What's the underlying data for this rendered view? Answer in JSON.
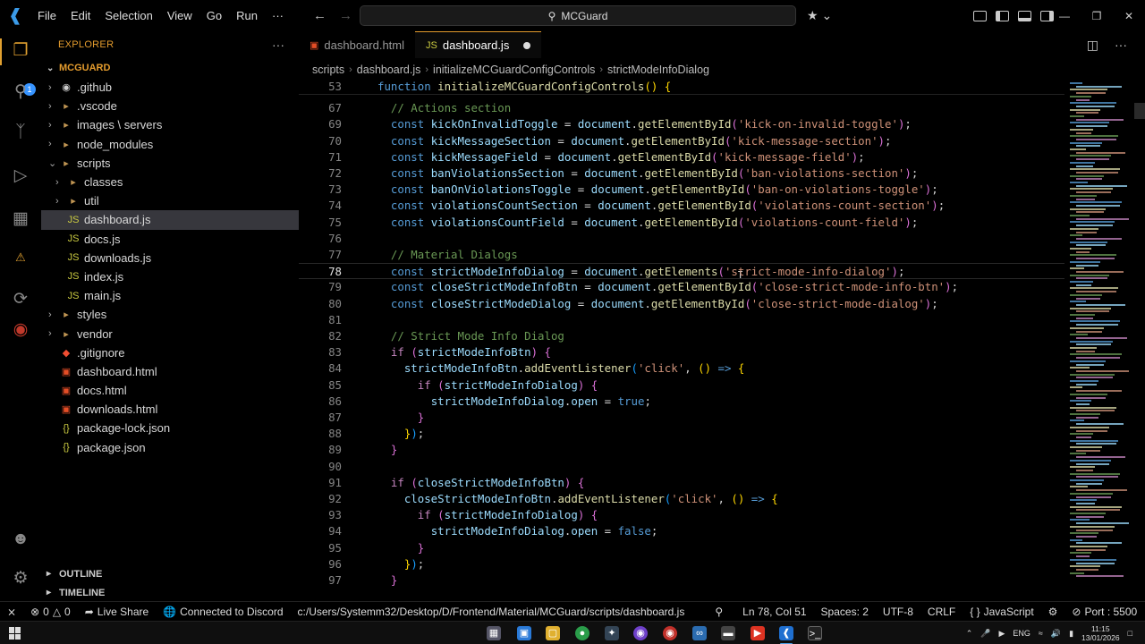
{
  "titlebar": {
    "menu": [
      "File",
      "Edit",
      "Selection",
      "View",
      "Go",
      "Run",
      "···"
    ],
    "search": "MCGuard"
  },
  "activity": {
    "badge": "1"
  },
  "sidebar": {
    "title": "EXPLORER",
    "more": "···",
    "root": "MCGUARD",
    "items": [
      {
        "label": ".github",
        "kind": "folder-gh",
        "indent": 0,
        "chev": "›"
      },
      {
        "label": ".vscode",
        "kind": "folder",
        "indent": 0,
        "chev": "›"
      },
      {
        "label": "images \\ servers",
        "kind": "folder",
        "indent": 0,
        "chev": "›"
      },
      {
        "label": "node_modules",
        "kind": "folder",
        "indent": 0,
        "chev": "›"
      },
      {
        "label": "scripts",
        "kind": "folder",
        "indent": 0,
        "chev": "⌄"
      },
      {
        "label": "classes",
        "kind": "folder",
        "indent": 1,
        "chev": "›"
      },
      {
        "label": "util",
        "kind": "folder",
        "indent": 1,
        "chev": "›"
      },
      {
        "label": "dashboard.js",
        "kind": "js",
        "indent": 1,
        "chev": "",
        "selected": true
      },
      {
        "label": "docs.js",
        "kind": "js",
        "indent": 1,
        "chev": ""
      },
      {
        "label": "downloads.js",
        "kind": "js",
        "indent": 1,
        "chev": ""
      },
      {
        "label": "index.js",
        "kind": "js",
        "indent": 1,
        "chev": ""
      },
      {
        "label": "main.js",
        "kind": "js",
        "indent": 1,
        "chev": ""
      },
      {
        "label": "styles",
        "kind": "folder",
        "indent": 0,
        "chev": "›"
      },
      {
        "label": "vendor",
        "kind": "folder",
        "indent": 0,
        "chev": "›"
      },
      {
        "label": ".gitignore",
        "kind": "git",
        "indent": 0,
        "chev": ""
      },
      {
        "label": "dashboard.html",
        "kind": "html",
        "indent": 0,
        "chev": ""
      },
      {
        "label": "docs.html",
        "kind": "html",
        "indent": 0,
        "chev": ""
      },
      {
        "label": "downloads.html",
        "kind": "html",
        "indent": 0,
        "chev": ""
      },
      {
        "label": "package-lock.json",
        "kind": "json",
        "indent": 0,
        "chev": ""
      },
      {
        "label": "package.json",
        "kind": "json",
        "indent": 0,
        "chev": ""
      }
    ],
    "outline": "OUTLINE",
    "timeline": "TIMELINE"
  },
  "tabs": [
    {
      "label": "dashboard.html",
      "kind": "html",
      "active": false
    },
    {
      "label": "dashboard.js",
      "kind": "js",
      "active": true,
      "dirty": true
    }
  ],
  "breadcrumb": [
    "scripts",
    "dashboard.js",
    "initializeMCGuardConfigControls",
    "strictModeInfoDialog"
  ],
  "editor": {
    "cursor_line": 78,
    "lines": [
      {
        "n": "53",
        "sticky": true,
        "t": [
          [
            "kw",
            "function "
          ],
          [
            "fn",
            "initializeMCGuardConfigControls"
          ],
          [
            "br1",
            "()"
          ],
          [
            "op",
            " "
          ],
          [
            "br1",
            "{"
          ]
        ]
      },
      {
        "n": "67",
        "t": [
          [
            "op",
            "  "
          ],
          [
            "cm",
            "// Actions section"
          ]
        ]
      },
      {
        "n": "69",
        "t": [
          [
            "op",
            "  "
          ],
          [
            "kw",
            "const "
          ],
          [
            "var",
            "kickOnInvalidToggle"
          ],
          [
            "op",
            " = "
          ],
          [
            "var",
            "document"
          ],
          [
            "op",
            "."
          ],
          [
            "fn",
            "getElementById"
          ],
          [
            "br2",
            "("
          ],
          [
            "str",
            "'kick-on-invalid-toggle'"
          ],
          [
            "br2",
            ")"
          ],
          [
            "op",
            ";"
          ]
        ]
      },
      {
        "n": "70",
        "t": [
          [
            "op",
            "  "
          ],
          [
            "kw",
            "const "
          ],
          [
            "var",
            "kickMessageSection"
          ],
          [
            "op",
            " = "
          ],
          [
            "var",
            "document"
          ],
          [
            "op",
            "."
          ],
          [
            "fn",
            "getElementById"
          ],
          [
            "br2",
            "("
          ],
          [
            "str",
            "'kick-message-section'"
          ],
          [
            "br2",
            ")"
          ],
          [
            "op",
            ";"
          ]
        ]
      },
      {
        "n": "71",
        "t": [
          [
            "op",
            "  "
          ],
          [
            "kw",
            "const "
          ],
          [
            "var",
            "kickMessageField"
          ],
          [
            "op",
            " = "
          ],
          [
            "var",
            "document"
          ],
          [
            "op",
            "."
          ],
          [
            "fn",
            "getElementById"
          ],
          [
            "br2",
            "("
          ],
          [
            "str",
            "'kick-message-field'"
          ],
          [
            "br2",
            ")"
          ],
          [
            "op",
            ";"
          ]
        ]
      },
      {
        "n": "72",
        "t": [
          [
            "op",
            "  "
          ],
          [
            "kw",
            "const "
          ],
          [
            "var",
            "banViolationsSection"
          ],
          [
            "op",
            " = "
          ],
          [
            "var",
            "document"
          ],
          [
            "op",
            "."
          ],
          [
            "fn",
            "getElementById"
          ],
          [
            "br2",
            "("
          ],
          [
            "str",
            "'ban-violations-section'"
          ],
          [
            "br2",
            ")"
          ],
          [
            "op",
            ";"
          ]
        ]
      },
      {
        "n": "73",
        "t": [
          [
            "op",
            "  "
          ],
          [
            "kw",
            "const "
          ],
          [
            "var",
            "banOnViolationsToggle"
          ],
          [
            "op",
            " = "
          ],
          [
            "var",
            "document"
          ],
          [
            "op",
            "."
          ],
          [
            "fn",
            "getElementById"
          ],
          [
            "br2",
            "("
          ],
          [
            "str",
            "'ban-on-violations-toggle'"
          ],
          [
            "br2",
            ")"
          ],
          [
            "op",
            ";"
          ]
        ]
      },
      {
        "n": "74",
        "t": [
          [
            "op",
            "  "
          ],
          [
            "kw",
            "const "
          ],
          [
            "var",
            "violationsCountSection"
          ],
          [
            "op",
            " = "
          ],
          [
            "var",
            "document"
          ],
          [
            "op",
            "."
          ],
          [
            "fn",
            "getElementById"
          ],
          [
            "br2",
            "("
          ],
          [
            "str",
            "'violations-count-section'"
          ],
          [
            "br2",
            ")"
          ],
          [
            "op",
            ";"
          ]
        ]
      },
      {
        "n": "75",
        "t": [
          [
            "op",
            "  "
          ],
          [
            "kw",
            "const "
          ],
          [
            "var",
            "violationsCountField"
          ],
          [
            "op",
            " = "
          ],
          [
            "var",
            "document"
          ],
          [
            "op",
            "."
          ],
          [
            "fn",
            "getElementById"
          ],
          [
            "br2",
            "("
          ],
          [
            "str",
            "'violations-count-field'"
          ],
          [
            "br2",
            ")"
          ],
          [
            "op",
            ";"
          ]
        ]
      },
      {
        "n": "76",
        "t": []
      },
      {
        "n": "77",
        "t": [
          [
            "op",
            "  "
          ],
          [
            "cm",
            "// Material Dialogs"
          ]
        ]
      },
      {
        "n": "78",
        "t": [
          [
            "op",
            "  "
          ],
          [
            "kw",
            "const "
          ],
          [
            "var",
            "strictModeInfoDialog"
          ],
          [
            "op",
            " = "
          ],
          [
            "var",
            "document"
          ],
          [
            "op",
            "."
          ],
          [
            "fn",
            "getElements"
          ],
          [
            "br2",
            "("
          ],
          [
            "str",
            "'strict-mode-info-dialog'"
          ],
          [
            "br2",
            ")"
          ],
          [
            "op",
            ";"
          ]
        ]
      },
      {
        "n": "79",
        "t": [
          [
            "op",
            "  "
          ],
          [
            "kw",
            "const "
          ],
          [
            "var",
            "closeStrictModeInfoBtn"
          ],
          [
            "op",
            " = "
          ],
          [
            "var",
            "document"
          ],
          [
            "op",
            "."
          ],
          [
            "fn",
            "getElementById"
          ],
          [
            "br2",
            "("
          ],
          [
            "str",
            "'close-strict-mode-info-btn'"
          ],
          [
            "br2",
            ")"
          ],
          [
            "op",
            ";"
          ]
        ]
      },
      {
        "n": "80",
        "t": [
          [
            "op",
            "  "
          ],
          [
            "kw",
            "const "
          ],
          [
            "var",
            "closeStrictModeDialog"
          ],
          [
            "op",
            " = "
          ],
          [
            "var",
            "document"
          ],
          [
            "op",
            "."
          ],
          [
            "fn",
            "getElementById"
          ],
          [
            "br2",
            "("
          ],
          [
            "str",
            "'close-strict-mode-dialog'"
          ],
          [
            "br2",
            ")"
          ],
          [
            "op",
            ";"
          ]
        ]
      },
      {
        "n": "81",
        "t": []
      },
      {
        "n": "82",
        "t": [
          [
            "op",
            "  "
          ],
          [
            "cm",
            "// Strict Mode Info Dialog"
          ]
        ]
      },
      {
        "n": "83",
        "t": [
          [
            "op",
            "  "
          ],
          [
            "ctrl",
            "if "
          ],
          [
            "br2",
            "("
          ],
          [
            "var",
            "strictModeInfoBtn"
          ],
          [
            "br2",
            ")"
          ],
          [
            "op",
            " "
          ],
          [
            "br2",
            "{"
          ]
        ]
      },
      {
        "n": "84",
        "t": [
          [
            "op",
            "    "
          ],
          [
            "var",
            "strictModeInfoBtn"
          ],
          [
            "op",
            "."
          ],
          [
            "fn",
            "addEventListener"
          ],
          [
            "br3",
            "("
          ],
          [
            "str",
            "'click'"
          ],
          [
            "op",
            ", "
          ],
          [
            "br1",
            "()"
          ],
          [
            "op",
            " "
          ],
          [
            "kw",
            "=>"
          ],
          [
            "op",
            " "
          ],
          [
            "br1",
            "{"
          ]
        ]
      },
      {
        "n": "85",
        "t": [
          [
            "op",
            "      "
          ],
          [
            "ctrl",
            "if "
          ],
          [
            "br2",
            "("
          ],
          [
            "var",
            "strictModeInfoDialog"
          ],
          [
            "br2",
            ")"
          ],
          [
            "op",
            " "
          ],
          [
            "br2",
            "{"
          ]
        ]
      },
      {
        "n": "86",
        "t": [
          [
            "op",
            "        "
          ],
          [
            "var",
            "strictModeInfoDialog"
          ],
          [
            "op",
            "."
          ],
          [
            "var",
            "open"
          ],
          [
            "op",
            " = "
          ],
          [
            "bool",
            "true"
          ],
          [
            "op",
            ";"
          ]
        ]
      },
      {
        "n": "87",
        "t": [
          [
            "op",
            "      "
          ],
          [
            "br2",
            "}"
          ]
        ]
      },
      {
        "n": "88",
        "t": [
          [
            "op",
            "    "
          ],
          [
            "br1",
            "}"
          ],
          [
            "br3",
            ")"
          ],
          [
            "op",
            ";"
          ]
        ]
      },
      {
        "n": "89",
        "t": [
          [
            "op",
            "  "
          ],
          [
            "br2",
            "}"
          ]
        ]
      },
      {
        "n": "90",
        "t": []
      },
      {
        "n": "91",
        "t": [
          [
            "op",
            "  "
          ],
          [
            "ctrl",
            "if "
          ],
          [
            "br2",
            "("
          ],
          [
            "var",
            "closeStrictModeInfoBtn"
          ],
          [
            "br2",
            ")"
          ],
          [
            "op",
            " "
          ],
          [
            "br2",
            "{"
          ]
        ]
      },
      {
        "n": "92",
        "t": [
          [
            "op",
            "    "
          ],
          [
            "var",
            "closeStrictModeInfoBtn"
          ],
          [
            "op",
            "."
          ],
          [
            "fn",
            "addEventListener"
          ],
          [
            "br3",
            "("
          ],
          [
            "str",
            "'click'"
          ],
          [
            "op",
            ", "
          ],
          [
            "br1",
            "()"
          ],
          [
            "op",
            " "
          ],
          [
            "kw",
            "=>"
          ],
          [
            "op",
            " "
          ],
          [
            "br1",
            "{"
          ]
        ]
      },
      {
        "n": "93",
        "t": [
          [
            "op",
            "      "
          ],
          [
            "ctrl",
            "if "
          ],
          [
            "br2",
            "("
          ],
          [
            "var",
            "strictModeInfoDialog"
          ],
          [
            "br2",
            ")"
          ],
          [
            "op",
            " "
          ],
          [
            "br2",
            "{"
          ]
        ]
      },
      {
        "n": "94",
        "t": [
          [
            "op",
            "        "
          ],
          [
            "var",
            "strictModeInfoDialog"
          ],
          [
            "op",
            "."
          ],
          [
            "var",
            "open"
          ],
          [
            "op",
            " = "
          ],
          [
            "bool",
            "false"
          ],
          [
            "op",
            ";"
          ]
        ]
      },
      {
        "n": "95",
        "t": [
          [
            "op",
            "      "
          ],
          [
            "br2",
            "}"
          ]
        ]
      },
      {
        "n": "96",
        "t": [
          [
            "op",
            "    "
          ],
          [
            "br1",
            "}"
          ],
          [
            "br3",
            ")"
          ],
          [
            "op",
            ";"
          ]
        ]
      },
      {
        "n": "97",
        "t": [
          [
            "op",
            "  "
          ],
          [
            "br2",
            "}"
          ]
        ]
      }
    ]
  },
  "statusbar": {
    "errors": "0",
    "warnings": "0",
    "liveshare": "Live Share",
    "discord": "Connected to Discord",
    "path": "c:/Users/Systemm32/Desktop/D/Frontend/Material/MCGuard/scripts/dashboard.js",
    "position": "Ln 78, Col 51",
    "spaces": "Spaces: 2",
    "encoding": "UTF-8",
    "eol": "CRLF",
    "language": "JavaScript",
    "port": "Port : 5500"
  },
  "taskbar": {
    "lang": "ENG",
    "time": "11:15",
    "date": "13/01/2026"
  },
  "colors": {
    "accent": "#e39b2d",
    "background": "#000000",
    "selection": "#37373d"
  }
}
